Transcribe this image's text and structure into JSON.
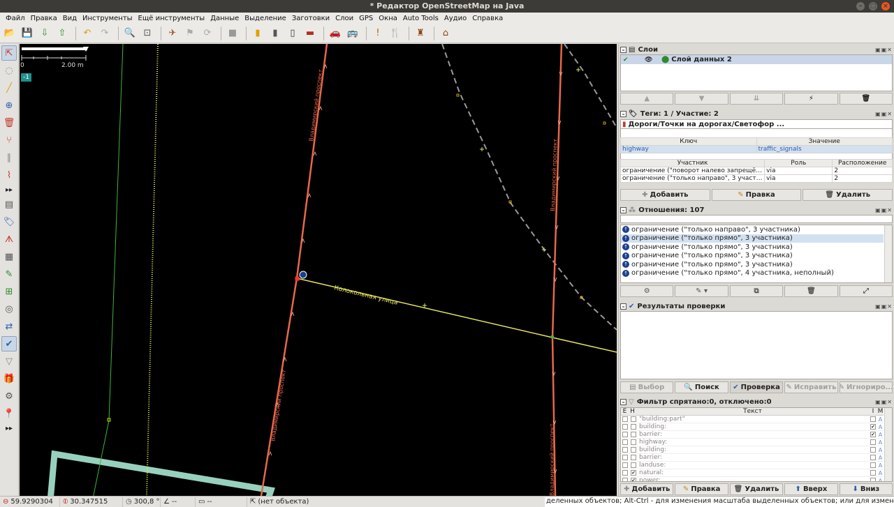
{
  "window": {
    "title": "* Редактор OpenStreetMap на Java",
    "controls": [
      "–",
      "□",
      "×"
    ]
  },
  "menu": [
    "Файл",
    "Правка",
    "Вид",
    "Инструменты",
    "Ещё инструменты",
    "Данные",
    "Выделение",
    "Заготовки",
    "Слои",
    "GPS",
    "Окна",
    "Auto Tools",
    "Аудио",
    "Справка"
  ],
  "toolbar": {
    "buttons": [
      {
        "name": "open-icon",
        "glyph": "📂",
        "color": "#2b5fa8"
      },
      {
        "name": "save-icon",
        "glyph": "💾",
        "color": "#2b5fa8"
      },
      {
        "name": "download-icon",
        "glyph": "⇩",
        "color": "#2f8a2f"
      },
      {
        "name": "upload-icon",
        "glyph": "⇧",
        "color": "#2f8a2f"
      },
      {
        "sep": true
      },
      {
        "name": "undo-icon",
        "glyph": "↶",
        "color": "#d4a017"
      },
      {
        "name": "redo-icon",
        "glyph": "↷",
        "color": "#aaa"
      },
      {
        "sep": true
      },
      {
        "name": "zoom-selection-icon",
        "glyph": "🔍",
        "color": "#555"
      },
      {
        "name": "zoom-data-icon",
        "glyph": "⊡",
        "color": "#555"
      },
      {
        "sep": true
      },
      {
        "name": "wms-icon",
        "glyph": "✈",
        "color": "#a0522d"
      },
      {
        "name": "imagery-icon",
        "glyph": "⚑",
        "color": "#aaa"
      },
      {
        "name": "refresh-icon",
        "glyph": "⟳",
        "color": "#aaa"
      },
      {
        "sep": true
      },
      {
        "name": "building-icon",
        "glyph": "■",
        "color": "#999"
      },
      {
        "sep": true
      },
      {
        "name": "road-yellow-icon",
        "glyph": "▮",
        "color": "#e0a000"
      },
      {
        "name": "road-grey-icon",
        "glyph": "▮",
        "color": "#555"
      },
      {
        "name": "traffic-signal-icon",
        "glyph": "▯",
        "color": "#333"
      },
      {
        "name": "brick-icon",
        "glyph": "▬",
        "color": "#b03020"
      },
      {
        "sep": true
      },
      {
        "name": "car-icon",
        "glyph": "🚗",
        "color": "#222"
      },
      {
        "name": "bus-icon",
        "glyph": "🚌",
        "color": "#222"
      },
      {
        "sep": true
      },
      {
        "name": "warning-icon",
        "glyph": "!",
        "color": "#c06000"
      },
      {
        "name": "restaurant-icon",
        "glyph": "🍴",
        "color": "#8b4513"
      },
      {
        "sep": true
      },
      {
        "name": "castle-icon",
        "glyph": "♜",
        "color": "#8b4513"
      },
      {
        "sep": true
      },
      {
        "name": "factory-icon",
        "glyph": "⌂",
        "color": "#8b4513"
      }
    ]
  },
  "lefttools": [
    {
      "name": "select-tool-icon",
      "glyph": "⇱",
      "on": true,
      "color": "#c0392b"
    },
    {
      "name": "lasso-tool-icon",
      "glyph": "◌",
      "on": false,
      "color": "#888"
    },
    {
      "name": "draw-tool-icon",
      "glyph": "╱",
      "on": false,
      "color": "#d4a017"
    },
    {
      "name": "zoom-tool-icon",
      "glyph": "⊕",
      "on": false,
      "color": "#2b5fa8"
    },
    {
      "name": "delete-tool-icon",
      "glyph": "🗑",
      "on": false,
      "color": "#c0392b"
    },
    {
      "name": "split-tool-icon",
      "glyph": "⑂",
      "on": false,
      "color": "#c0392b"
    },
    {
      "name": "parallel-tool-icon",
      "glyph": "∥",
      "on": false,
      "color": "#888"
    },
    {
      "name": "improve-way-tool-icon",
      "glyph": "⌇",
      "on": false,
      "color": "#c0392b"
    },
    {
      "more": true
    },
    {
      "name": "layer-list-icon",
      "glyph": "▤",
      "on": false,
      "color": "#555"
    },
    {
      "name": "tag-icon",
      "glyph": "🏷",
      "on": false,
      "color": "#2b5fa8"
    },
    {
      "name": "relation-icon",
      "glyph": "ᗑ",
      "on": false,
      "color": "#c0392b"
    },
    {
      "name": "select-list-icon",
      "glyph": "▦",
      "on": false,
      "color": "#555"
    },
    {
      "name": "history-icon",
      "glyph": "✎",
      "on": false,
      "color": "#2f8a2f"
    },
    {
      "name": "conflict-icon",
      "glyph": "⊞",
      "on": false,
      "color": "#2f8a2f"
    },
    {
      "name": "minimap-icon",
      "glyph": "◎",
      "on": false,
      "color": "#555"
    },
    {
      "name": "commands-icon",
      "glyph": "⇄",
      "on": false,
      "color": "#2b5fa8"
    },
    {
      "name": "validator-icon",
      "glyph": "✔",
      "on": true,
      "color": "#2b5fa8"
    },
    {
      "name": "filter-icon",
      "glyph": "▽",
      "on": false,
      "color": "#888"
    },
    {
      "name": "changeset-icon",
      "glyph": "🎁",
      "on": false,
      "color": "#c0392b"
    },
    {
      "name": "measurement-icon",
      "glyph": "⚙",
      "on": false,
      "color": "#555"
    },
    {
      "name": "poi-icon",
      "glyph": "📍",
      "on": false,
      "color": "#c0392b"
    },
    {
      "more": true
    }
  ],
  "map": {
    "scale_label": "2.00 m",
    "zoom_badge": "-1",
    "street_labels": [
      {
        "text": "Колокольная улица"
      },
      {
        "text": "Владимирский проспект"
      },
      {
        "text": "Владимирский проспект"
      },
      {
        "text": "Владимирский проспект"
      },
      {
        "text": "Владимирский проспект"
      }
    ]
  },
  "layers": {
    "title": "Слои",
    "items": [
      {
        "name": "Слой данных 2"
      }
    ],
    "buttons": [
      {
        "name": "layer-up-icon",
        "glyph": "▲",
        "dis": true
      },
      {
        "name": "layer-down-icon",
        "glyph": "▼",
        "dis": true
      },
      {
        "name": "layer-merge-icon",
        "glyph": "⇊",
        "dis": true
      },
      {
        "name": "layer-visibility-icon",
        "glyph": "⚡",
        "dis": false
      },
      {
        "name": "layer-delete-icon",
        "glyph": "🗑",
        "dis": false
      }
    ]
  },
  "tags": {
    "title": "Теги: 1 / Участие: 2",
    "preset": "Дороги/Точки на дорогах/Светофор ...",
    "headers": [
      "Ключ",
      "Значение"
    ],
    "rows": [
      [
        "highway",
        "traffic_signals"
      ]
    ],
    "member_headers": [
      "Участник",
      "Роль",
      "Расположение"
    ],
    "members": [
      [
        "ограничение (\"поворот налево запрещён\",...",
        "via",
        "2"
      ],
      [
        "ограничение (\"только направо\", 3 участни...",
        "via",
        "2"
      ]
    ],
    "buttons": [
      "Добавить",
      "Правка",
      "Удалить"
    ]
  },
  "relations": {
    "title": "Отношения: 107",
    "items": [
      "ограничение (\"только направо\", 3 участника)",
      "ограничение (\"только прямо\", 3 участника)",
      "ограничение (\"только прямо\", 3 участника)",
      "ограничение (\"только прямо\", 3 участника)",
      "ограничение (\"только прямо\", 3 участника)",
      "ограничение (\"только прямо\", 4 участника, неполный)"
    ],
    "buttons": [
      {
        "name": "relation-select-icon",
        "glyph": "⚙"
      },
      {
        "name": "relation-edit-icon",
        "glyph": "✎ ▾"
      },
      {
        "name": "relation-duplicate-icon",
        "glyph": "⧉"
      },
      {
        "name": "relation-delete-icon",
        "glyph": "🗑"
      },
      {
        "name": "relation-select-members-icon",
        "glyph": "⤢"
      }
    ]
  },
  "validation": {
    "title": "Результаты проверки",
    "buttons": [
      {
        "label": "Выбор",
        "dis": true
      },
      {
        "label": "Поиск",
        "dis": false
      },
      {
        "label": "Проверка",
        "dis": false
      },
      {
        "label": "Исправить",
        "dis": true
      },
      {
        "label": "Игнориро...",
        "dis": true
      }
    ]
  },
  "filter": {
    "title": "Фильтр спрятано:0, отключено:0",
    "headers": [
      "E",
      "H",
      "Текст",
      "I",
      "M"
    ],
    "rows": [
      {
        "text": "\"building:part\"",
        "e": false,
        "h": false,
        "i": false,
        "m": "A"
      },
      {
        "text": "building:",
        "e": false,
        "h": false,
        "i": true,
        "m": "A"
      },
      {
        "text": "barrier:",
        "e": false,
        "h": false,
        "i": true,
        "m": "A"
      },
      {
        "text": "highway:",
        "e": false,
        "h": false,
        "i": false,
        "m": "A"
      },
      {
        "text": "building:",
        "e": false,
        "h": false,
        "i": false,
        "m": "A"
      },
      {
        "text": "barrier:",
        "e": false,
        "h": false,
        "i": false,
        "m": "A"
      },
      {
        "text": "landuse:",
        "e": false,
        "h": false,
        "i": false,
        "m": "A"
      },
      {
        "text": "natural:",
        "e": false,
        "h": true,
        "i": false,
        "m": "A"
      },
      {
        "text": "power:",
        "e": false,
        "h": true,
        "i": false,
        "m": "A"
      }
    ],
    "buttons": [
      "Добавить",
      "Правка",
      "Удалить",
      "Вверх",
      "Вниз"
    ]
  },
  "status": {
    "lat": "59.9290304",
    "lon": "30.347515",
    "heading": "300,8 °",
    "angle": "--",
    "distance": "--",
    "object": "(нет объекта)",
    "help": "деленных объектов; Alt-Ctrl - для изменения масштаба выделенных объектов; или для изменения выделения"
  },
  "colors": {
    "road_red": "#e8684a",
    "road_yellow": "#e6e65c",
    "path_green": "#3fb53f",
    "path_grey": "#9a9a9a",
    "building": "#9fdcc8",
    "accent": "#1f8f8b"
  }
}
